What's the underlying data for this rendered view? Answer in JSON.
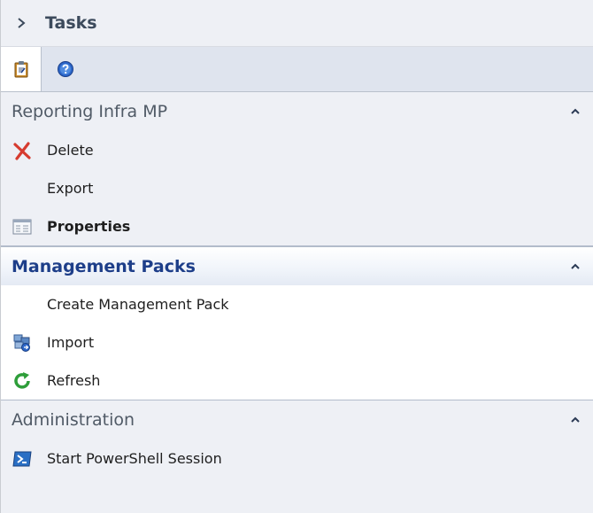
{
  "header": {
    "title": "Tasks",
    "expand_icon": "chevron-right-icon"
  },
  "tabs": [
    {
      "name": "tasks",
      "icon": "clipboard-icon"
    },
    {
      "name": "help",
      "icon": "help-icon"
    }
  ],
  "sections": {
    "reporting": {
      "title": "Reporting Infra MP",
      "collapse_icon": "chevron-up-icon",
      "items": [
        {
          "label": "Delete",
          "icon": "delete-x-icon"
        },
        {
          "label": "Export",
          "icon": ""
        },
        {
          "label": "Properties",
          "icon": "properties-icon"
        }
      ]
    },
    "management_packs": {
      "title": "Management Packs",
      "collapse_icon": "chevron-up-icon",
      "items": [
        {
          "label": "Create Management Pack",
          "icon": ""
        },
        {
          "label": "Import",
          "icon": "import-icon"
        },
        {
          "label": "Refresh",
          "icon": "refresh-icon"
        }
      ]
    },
    "administration": {
      "title": "Administration",
      "collapse_icon": "chevron-up-icon",
      "items": [
        {
          "label": "Start PowerShell Session",
          "icon": "powershell-icon"
        }
      ]
    }
  },
  "colors": {
    "accent_title": "#1d3e89",
    "delete_red": "#d63b2f",
    "refresh_green": "#2e9e3a"
  }
}
